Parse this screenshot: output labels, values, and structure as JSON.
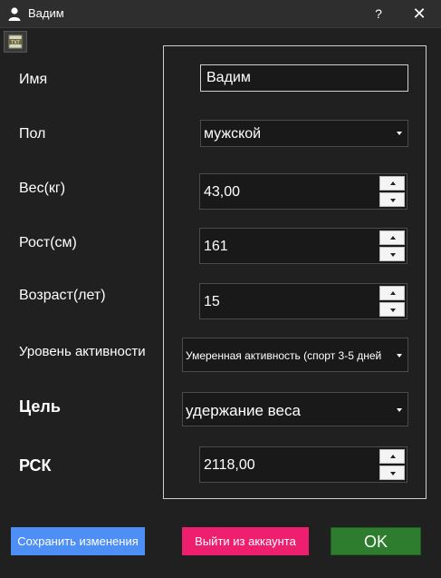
{
  "window": {
    "title": "Вадим",
    "help_label": "?",
    "close_label": "✕",
    "icon": "user-icon"
  },
  "toolbar": {
    "icon": "text-file-icon",
    "icon_text": "TXT"
  },
  "form": {
    "name": {
      "label": "Имя",
      "value": "Вадим"
    },
    "sex": {
      "label": "Пол",
      "value": "мужской"
    },
    "weight": {
      "label": "Вес(кг)",
      "value": "43,00"
    },
    "height": {
      "label": "Рост(см)",
      "value": "161"
    },
    "age": {
      "label": "Возраст(лет)",
      "value": "15"
    },
    "activity": {
      "label": "Уровень активности",
      "value": "Умеренная активность (спорт 3-5 дней"
    },
    "goal": {
      "label": "Цель",
      "value": "удержание веса"
    },
    "rsk": {
      "label": "РСК",
      "value": "2118,00"
    }
  },
  "buttons": {
    "save": "Сохранить изменения",
    "logout": "Выйти из аккаунта",
    "ok": "OK"
  },
  "colors": {
    "save": "#4e8ff5",
    "logout": "#ee1f6e",
    "ok": "#2e7d2e",
    "background": "#202020"
  }
}
